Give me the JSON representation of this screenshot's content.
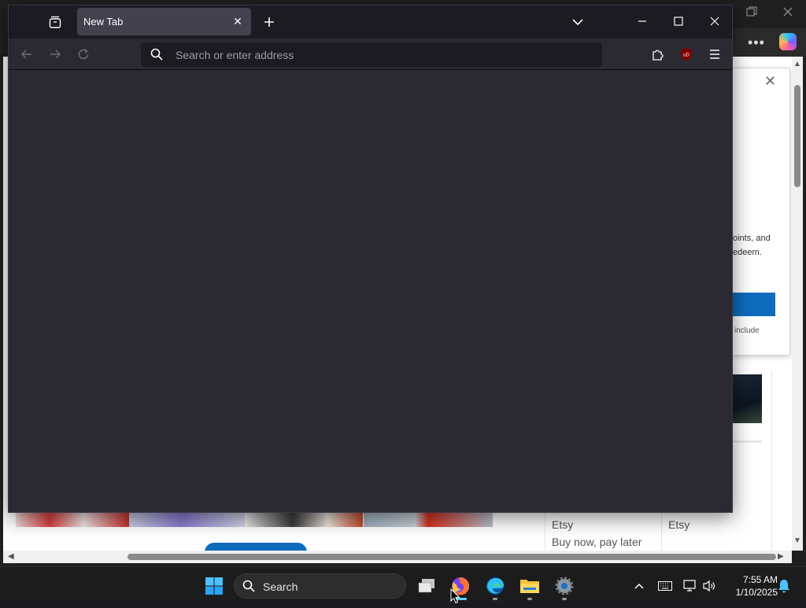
{
  "firefox": {
    "tab_title": "New Tab",
    "urlbar_placeholder": "Search or enter address"
  },
  "background_window": {
    "popup_text_1": "oints, and",
    "popup_text_2": "edeem.",
    "popup_text_3": "include",
    "etsy_label_1": "Etsy",
    "etsy_label_2": "Etsy",
    "buy_now_text": "Buy now, pay later"
  },
  "taskbar": {
    "search_label": "Search",
    "apps": [
      "task-view",
      "firefox",
      "edge",
      "file-explorer",
      "settings"
    ],
    "active_app": "firefox"
  },
  "clock": {
    "time": "7:55 AM",
    "date": "1/10/2025"
  },
  "colors": {
    "firefox_chrome": "#1c1b22",
    "firefox_content": "#2b2a33",
    "urlbar": "#1c1b22",
    "taskbar": "#1c1c1c",
    "accent": "#60cdff",
    "edge_button": "#0f6cbd"
  }
}
